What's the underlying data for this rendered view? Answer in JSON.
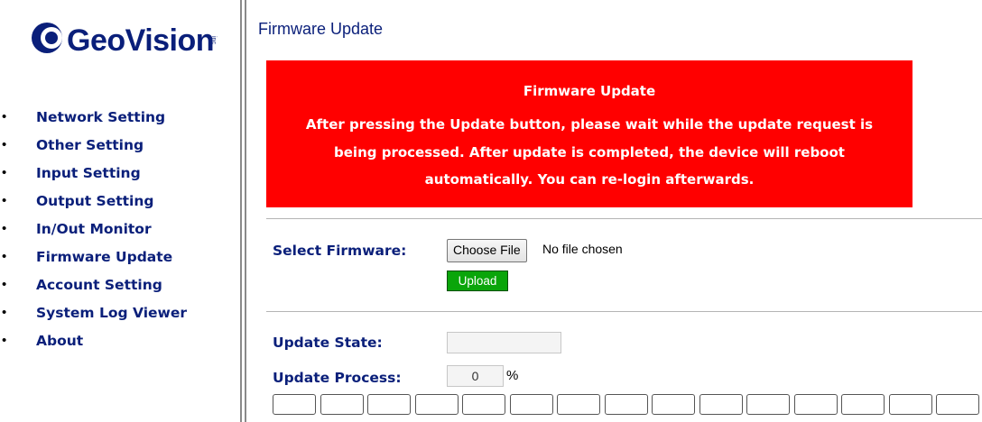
{
  "brand": {
    "name": "GeoVision",
    "suffix": "inc"
  },
  "sidebar": {
    "items": [
      {
        "label": "Network Setting"
      },
      {
        "label": "Other Setting"
      },
      {
        "label": "Input Setting"
      },
      {
        "label": "Output Setting"
      },
      {
        "label": "In/Out Monitor"
      },
      {
        "label": "Firmware Update"
      },
      {
        "label": "Account Setting"
      },
      {
        "label": "System Log Viewer"
      },
      {
        "label": "About"
      }
    ],
    "bullet": "•"
  },
  "main": {
    "page_title": "Firmware Update",
    "alert": {
      "title": "Firmware Update",
      "message": "After pressing the Update button, please wait while the update request is being processed. After update is completed, the device will reboot automatically. You can re-login afterwards.",
      "color": "#ff0000"
    },
    "select_firmware_label": "Select Firmware:",
    "choose_file_label": "Choose File",
    "no_file_text": "No file chosen",
    "upload_label": "Upload",
    "update_state_label": "Update State:",
    "update_state_value": "",
    "update_process_label": "Update Process:",
    "update_process_value": "0",
    "percent_sign": "%",
    "progress_cells": 15,
    "progress_fraction": 0
  },
  "colors": {
    "nav_text": "#0a1f7a",
    "upload_green": "#0aa50a",
    "alert_red": "#ff0000"
  }
}
